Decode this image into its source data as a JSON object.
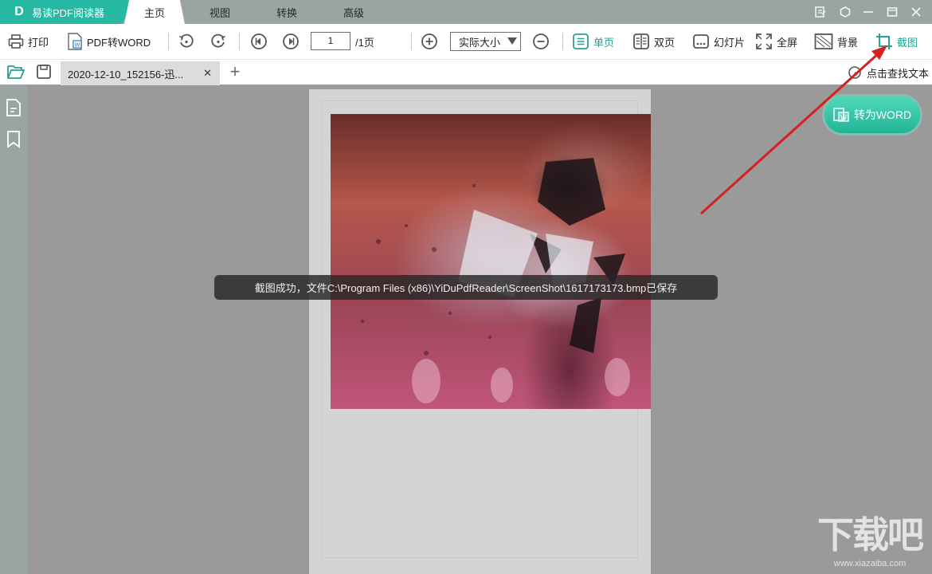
{
  "app": {
    "title": "易读PDF阅读器",
    "logo_letter": "D"
  },
  "menu": {
    "tabs": [
      {
        "label": "主页"
      },
      {
        "label": "视图"
      },
      {
        "label": "转换"
      },
      {
        "label": "高级"
      }
    ],
    "active_tab": "主页"
  },
  "toolbar": {
    "print": "打印",
    "pdf_to_word": "PDF转WORD",
    "page_current": "1",
    "page_total": "/1页",
    "zoom": "实际大小",
    "single": "单页",
    "double": "双页",
    "slideshow": "幻灯片",
    "fullscreen": "全屏",
    "background": "背景",
    "screenshot": "截图"
  },
  "tabs": {
    "doc_title": "2020-12-10_152156-迅...",
    "find_text": "点击查找文本"
  },
  "toast": "截图成功，文件C:\\Program Files (x86)\\YiDuPdfReader\\ScreenShot\\1617173173.bmp已保存",
  "convert_button": "转为WORD",
  "watermark": {
    "main": "下载吧",
    "sub": "www.xiazaiba.com"
  },
  "colors": {
    "accent": "#26b8a3",
    "arrow": "#d42020"
  }
}
